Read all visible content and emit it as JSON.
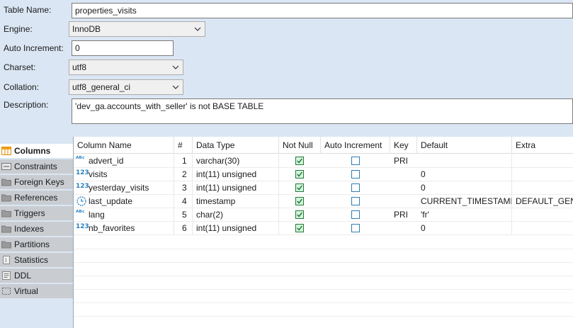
{
  "form": {
    "table_name_label": "Table Name:",
    "table_name_value": "properties_visits",
    "engine_label": "Engine:",
    "engine_value": "InnoDB",
    "auto_increment_label": "Auto Increment:",
    "auto_increment_value": "0",
    "charset_label": "Charset:",
    "charset_value": "utf8",
    "collation_label": "Collation:",
    "collation_value": "utf8_general_ci",
    "description_label": "Description:",
    "description_value": "'dev_ga.accounts_with_seller' is not BASE TABLE"
  },
  "tabs": [
    {
      "label": "Columns",
      "icon": "columns-icon",
      "active": true
    },
    {
      "label": "Constraints",
      "icon": "constraints-icon"
    },
    {
      "label": "Foreign Keys",
      "icon": "folder-icon"
    },
    {
      "label": "References",
      "icon": "folder-icon"
    },
    {
      "label": "Triggers",
      "icon": "folder-icon"
    },
    {
      "label": "Indexes",
      "icon": "folder-icon"
    },
    {
      "label": "Partitions",
      "icon": "folder-icon"
    },
    {
      "label": "Statistics",
      "icon": "statistics-icon"
    },
    {
      "label": "DDL",
      "icon": "ddl-icon"
    },
    {
      "label": "Virtual",
      "icon": "virtual-icon"
    }
  ],
  "columns_header": [
    "Column Name",
    "#",
    "Data Type",
    "Not Null",
    "Auto Increment",
    "Key",
    "Default",
    "Extra"
  ],
  "rows": [
    {
      "icon": "abc",
      "name": "advert_id",
      "num": "1",
      "type": "varchar(30)",
      "not_null": true,
      "auto_inc": false,
      "key": "PRI",
      "default": "",
      "extra": ""
    },
    {
      "icon": "123",
      "name": "visits",
      "num": "2",
      "type": "int(11) unsigned",
      "not_null": true,
      "auto_inc": false,
      "key": "",
      "default": "0",
      "extra": ""
    },
    {
      "icon": "123",
      "name": "yesterday_visits",
      "num": "3",
      "type": "int(11) unsigned",
      "not_null": true,
      "auto_inc": false,
      "key": "",
      "default": "0",
      "extra": ""
    },
    {
      "icon": "clock",
      "name": "last_update",
      "num": "4",
      "type": "timestamp",
      "not_null": true,
      "auto_inc": false,
      "key": "",
      "default": "CURRENT_TIMESTAMP",
      "extra": "DEFAULT_GENE"
    },
    {
      "icon": "abc",
      "name": "lang",
      "num": "5",
      "type": "char(2)",
      "not_null": true,
      "auto_inc": false,
      "key": "PRI",
      "default": "'fr'",
      "extra": ""
    },
    {
      "icon": "123",
      "name": "nb_favorites",
      "num": "6",
      "type": "int(11) unsigned",
      "not_null": true,
      "auto_inc": false,
      "key": "",
      "default": "0",
      "extra": ""
    }
  ],
  "colors": {
    "accent": "#2a7fc0",
    "background": "#dae6f3",
    "check": "#1e7b3a"
  }
}
